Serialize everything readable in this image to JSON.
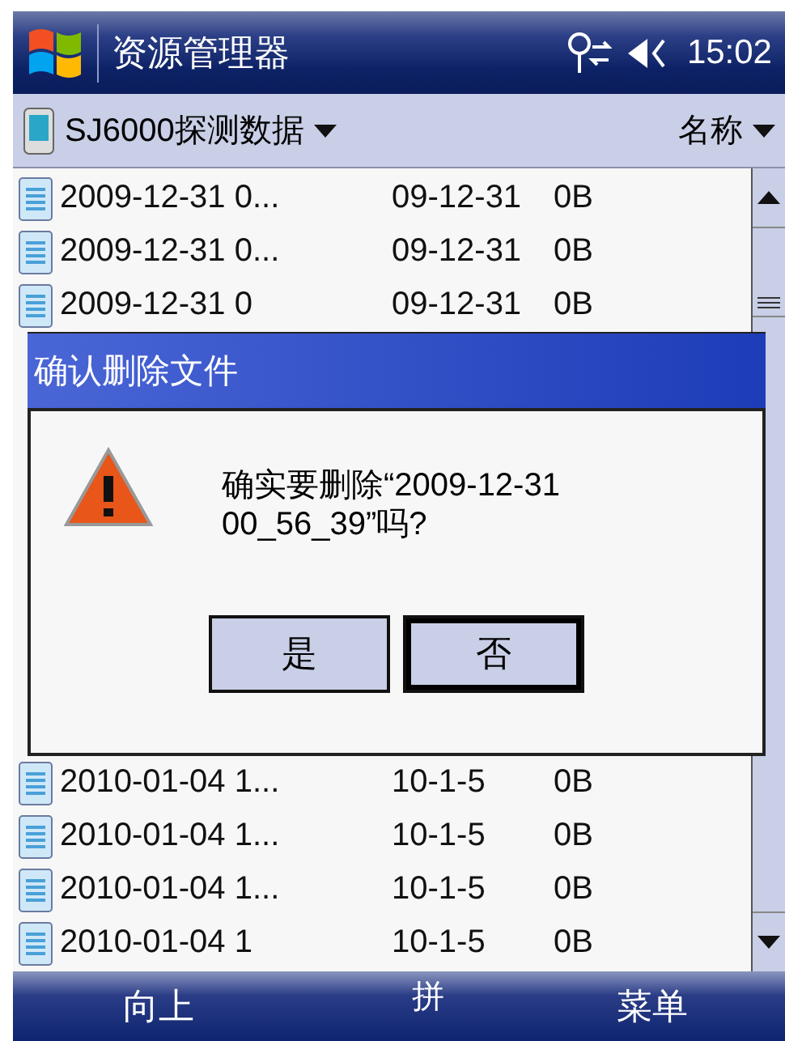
{
  "title_bar": {
    "title": "资源管理器",
    "time": "15:02"
  },
  "folder_bar": {
    "folder": "SJ6000探测数据",
    "sort": "名称"
  },
  "files": [
    {
      "name": "2009-12-31 0...",
      "date": "09-12-31",
      "size": "0B"
    },
    {
      "name": "2009-12-31 0...",
      "date": "09-12-31",
      "size": "0B"
    },
    {
      "name": "2009-12-31 0",
      "date": "09-12-31",
      "size": "0B"
    }
  ],
  "files_below": [
    {
      "name": "2010-01-04 1...",
      "date": "10-1-5",
      "size": "0B"
    },
    {
      "name": "2010-01-04 1...",
      "date": "10-1-5",
      "size": "0B"
    },
    {
      "name": "2010-01-04 1...",
      "date": "10-1-5",
      "size": "0B"
    },
    {
      "name": "2010-01-04 1",
      "date": "10-1-5",
      "size": "0B"
    }
  ],
  "dialog": {
    "title": "确认删除文件",
    "message": "确实要删除“2009-12-31 00_56_39”吗?",
    "buttons": [
      {
        "label": "是",
        "focused": false
      },
      {
        "label": "否",
        "focused": true
      }
    ]
  },
  "soft_keys": {
    "left": "向上",
    "input": "拼",
    "right": "菜单"
  }
}
